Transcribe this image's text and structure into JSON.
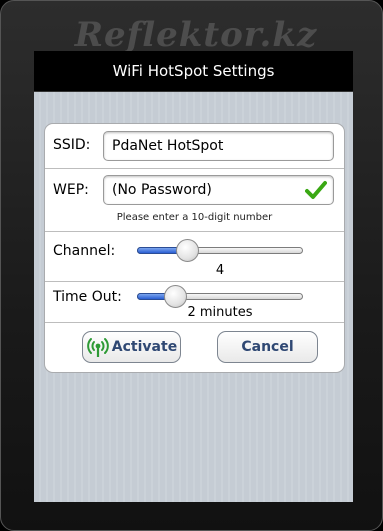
{
  "watermark": "Reflektor.kz",
  "header": {
    "title": "WiFi HotSpot Settings"
  },
  "form": {
    "ssid": {
      "label": "SSID:",
      "value": "PdaNet HotSpot"
    },
    "wep": {
      "label": "WEP:",
      "value": "(No Password)",
      "hint": "Please enter a 10-digit number",
      "valid_icon": "checkmark-icon"
    },
    "channel": {
      "label": "Channel:",
      "value": "4",
      "level": 0.3
    },
    "timeout": {
      "label": "Time Out:",
      "value": "2 minutes",
      "level": 0.23
    }
  },
  "buttons": {
    "activate": {
      "label": "Activate",
      "icon": "wifi-signal-icon"
    },
    "cancel": {
      "label": "Cancel"
    }
  },
  "colors": {
    "button_text": "#2f4873",
    "slider_fill": "#2a5ed3",
    "check_green": "#3aa814",
    "signal_green": "#2d9a35"
  }
}
